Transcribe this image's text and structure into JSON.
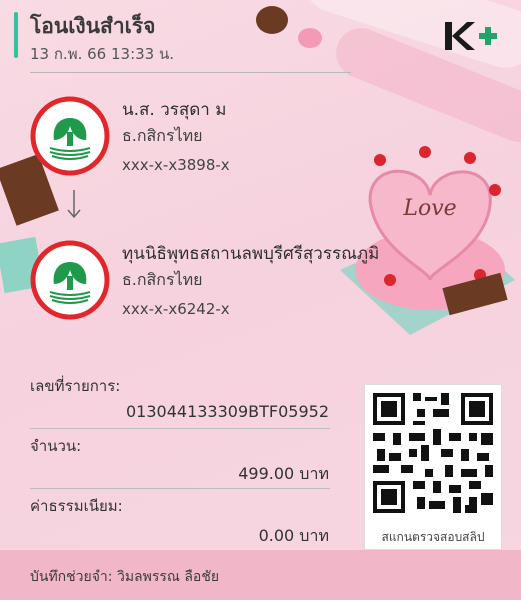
{
  "header": {
    "title": "โอนเงินสำเร็จ",
    "datetime": "13 ก.พ. 66  13:33 น."
  },
  "brand": {
    "name": "K+",
    "color": "#1fa46a",
    "accent": "#2ec39a"
  },
  "sender": {
    "name": "น.ส. วรสุดา ม",
    "bank": "ธ.กสิกรไทย",
    "account": "xxx-x-x3898-x"
  },
  "receiver": {
    "name": "ทุนนิธิพุทธสถานลพบุรีศรีสุวรรณภูมิ",
    "bank": "ธ.กสิกรไทย",
    "account": "xxx-x-x6242-x"
  },
  "transaction": {
    "ref_label": "เลขที่รายการ:",
    "ref_value": "013044133309BTF05952",
    "amount_label": "จำนวน:",
    "amount_value": "499.00 บาท",
    "fee_label": "ค่าธรรมเนียม:",
    "fee_value": "0.00 บาท"
  },
  "qr": {
    "caption": "สแกนตรวจสอบสลิป"
  },
  "footer": {
    "memo": "บันทึกช่วยจำ: วิมลพรรณ ลือชัย"
  },
  "colors": {
    "kbank_green": "#1f9a4a",
    "kbank_red": "#e0272c",
    "footer_bg": "#f2b6c9"
  }
}
